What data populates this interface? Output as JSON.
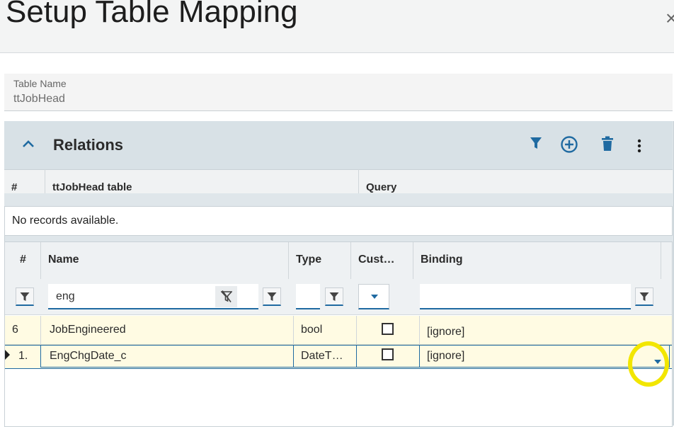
{
  "header": {
    "title": "Setup Table Mapping",
    "close_glyph": "×"
  },
  "table_name": {
    "label": "Table Name",
    "value": "ttJobHead"
  },
  "relations": {
    "title": "Relations",
    "columns": [
      "#",
      "ttJobHead table",
      "Query"
    ],
    "empty_message": "No records available."
  },
  "fields": {
    "columns": [
      "#",
      "Name",
      "Type",
      "Cust…",
      "Binding"
    ],
    "filter": {
      "name_value": "eng"
    },
    "rows": [
      {
        "num": "6",
        "name": "JobEngineered",
        "type": "bool",
        "custom": false,
        "binding": "[ignore]"
      },
      {
        "num": "1.",
        "name": "EngChgDate_c",
        "type": "DateT…",
        "custom": false,
        "binding": "[ignore]"
      }
    ]
  },
  "colors": {
    "accent": "#1f6aa1",
    "row_highlight": "#fffbe3",
    "annotation": "#f2e600"
  }
}
